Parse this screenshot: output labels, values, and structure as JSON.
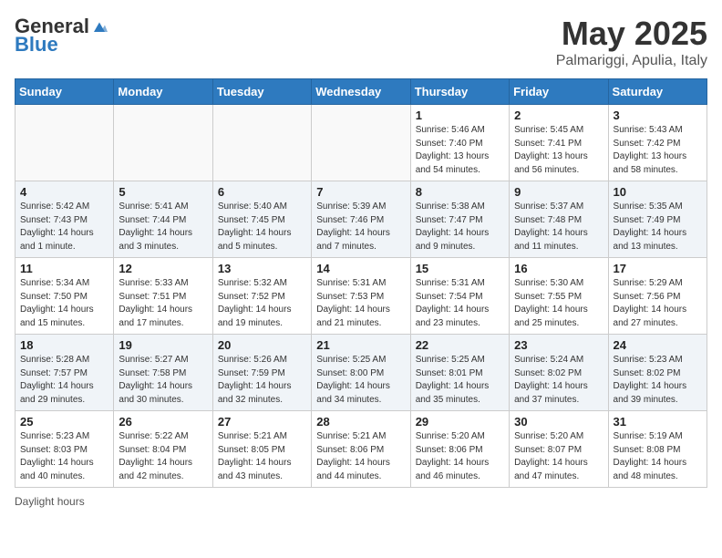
{
  "header": {
    "logo_general": "General",
    "logo_blue": "Blue",
    "title": "May 2025",
    "subtitle": "Palmariggi, Apulia, Italy"
  },
  "days_of_week": [
    "Sunday",
    "Monday",
    "Tuesday",
    "Wednesday",
    "Thursday",
    "Friday",
    "Saturday"
  ],
  "footer": {
    "daylight_hours_label": "Daylight hours"
  },
  "weeks": [
    {
      "days": [
        {
          "num": "",
          "info": ""
        },
        {
          "num": "",
          "info": ""
        },
        {
          "num": "",
          "info": ""
        },
        {
          "num": "",
          "info": ""
        },
        {
          "num": "1",
          "info": "Sunrise: 5:46 AM\nSunset: 7:40 PM\nDaylight: 13 hours\nand 54 minutes."
        },
        {
          "num": "2",
          "info": "Sunrise: 5:45 AM\nSunset: 7:41 PM\nDaylight: 13 hours\nand 56 minutes."
        },
        {
          "num": "3",
          "info": "Sunrise: 5:43 AM\nSunset: 7:42 PM\nDaylight: 13 hours\nand 58 minutes."
        }
      ]
    },
    {
      "days": [
        {
          "num": "4",
          "info": "Sunrise: 5:42 AM\nSunset: 7:43 PM\nDaylight: 14 hours\nand 1 minute."
        },
        {
          "num": "5",
          "info": "Sunrise: 5:41 AM\nSunset: 7:44 PM\nDaylight: 14 hours\nand 3 minutes."
        },
        {
          "num": "6",
          "info": "Sunrise: 5:40 AM\nSunset: 7:45 PM\nDaylight: 14 hours\nand 5 minutes."
        },
        {
          "num": "7",
          "info": "Sunrise: 5:39 AM\nSunset: 7:46 PM\nDaylight: 14 hours\nand 7 minutes."
        },
        {
          "num": "8",
          "info": "Sunrise: 5:38 AM\nSunset: 7:47 PM\nDaylight: 14 hours\nand 9 minutes."
        },
        {
          "num": "9",
          "info": "Sunrise: 5:37 AM\nSunset: 7:48 PM\nDaylight: 14 hours\nand 11 minutes."
        },
        {
          "num": "10",
          "info": "Sunrise: 5:35 AM\nSunset: 7:49 PM\nDaylight: 14 hours\nand 13 minutes."
        }
      ]
    },
    {
      "days": [
        {
          "num": "11",
          "info": "Sunrise: 5:34 AM\nSunset: 7:50 PM\nDaylight: 14 hours\nand 15 minutes."
        },
        {
          "num": "12",
          "info": "Sunrise: 5:33 AM\nSunset: 7:51 PM\nDaylight: 14 hours\nand 17 minutes."
        },
        {
          "num": "13",
          "info": "Sunrise: 5:32 AM\nSunset: 7:52 PM\nDaylight: 14 hours\nand 19 minutes."
        },
        {
          "num": "14",
          "info": "Sunrise: 5:31 AM\nSunset: 7:53 PM\nDaylight: 14 hours\nand 21 minutes."
        },
        {
          "num": "15",
          "info": "Sunrise: 5:31 AM\nSunset: 7:54 PM\nDaylight: 14 hours\nand 23 minutes."
        },
        {
          "num": "16",
          "info": "Sunrise: 5:30 AM\nSunset: 7:55 PM\nDaylight: 14 hours\nand 25 minutes."
        },
        {
          "num": "17",
          "info": "Sunrise: 5:29 AM\nSunset: 7:56 PM\nDaylight: 14 hours\nand 27 minutes."
        }
      ]
    },
    {
      "days": [
        {
          "num": "18",
          "info": "Sunrise: 5:28 AM\nSunset: 7:57 PM\nDaylight: 14 hours\nand 29 minutes."
        },
        {
          "num": "19",
          "info": "Sunrise: 5:27 AM\nSunset: 7:58 PM\nDaylight: 14 hours\nand 30 minutes."
        },
        {
          "num": "20",
          "info": "Sunrise: 5:26 AM\nSunset: 7:59 PM\nDaylight: 14 hours\nand 32 minutes."
        },
        {
          "num": "21",
          "info": "Sunrise: 5:25 AM\nSunset: 8:00 PM\nDaylight: 14 hours\nand 34 minutes."
        },
        {
          "num": "22",
          "info": "Sunrise: 5:25 AM\nSunset: 8:01 PM\nDaylight: 14 hours\nand 35 minutes."
        },
        {
          "num": "23",
          "info": "Sunrise: 5:24 AM\nSunset: 8:02 PM\nDaylight: 14 hours\nand 37 minutes."
        },
        {
          "num": "24",
          "info": "Sunrise: 5:23 AM\nSunset: 8:02 PM\nDaylight: 14 hours\nand 39 minutes."
        }
      ]
    },
    {
      "days": [
        {
          "num": "25",
          "info": "Sunrise: 5:23 AM\nSunset: 8:03 PM\nDaylight: 14 hours\nand 40 minutes."
        },
        {
          "num": "26",
          "info": "Sunrise: 5:22 AM\nSunset: 8:04 PM\nDaylight: 14 hours\nand 42 minutes."
        },
        {
          "num": "27",
          "info": "Sunrise: 5:21 AM\nSunset: 8:05 PM\nDaylight: 14 hours\nand 43 minutes."
        },
        {
          "num": "28",
          "info": "Sunrise: 5:21 AM\nSunset: 8:06 PM\nDaylight: 14 hours\nand 44 minutes."
        },
        {
          "num": "29",
          "info": "Sunrise: 5:20 AM\nSunset: 8:06 PM\nDaylight: 14 hours\nand 46 minutes."
        },
        {
          "num": "30",
          "info": "Sunrise: 5:20 AM\nSunset: 8:07 PM\nDaylight: 14 hours\nand 47 minutes."
        },
        {
          "num": "31",
          "info": "Sunrise: 5:19 AM\nSunset: 8:08 PM\nDaylight: 14 hours\nand 48 minutes."
        }
      ]
    }
  ]
}
